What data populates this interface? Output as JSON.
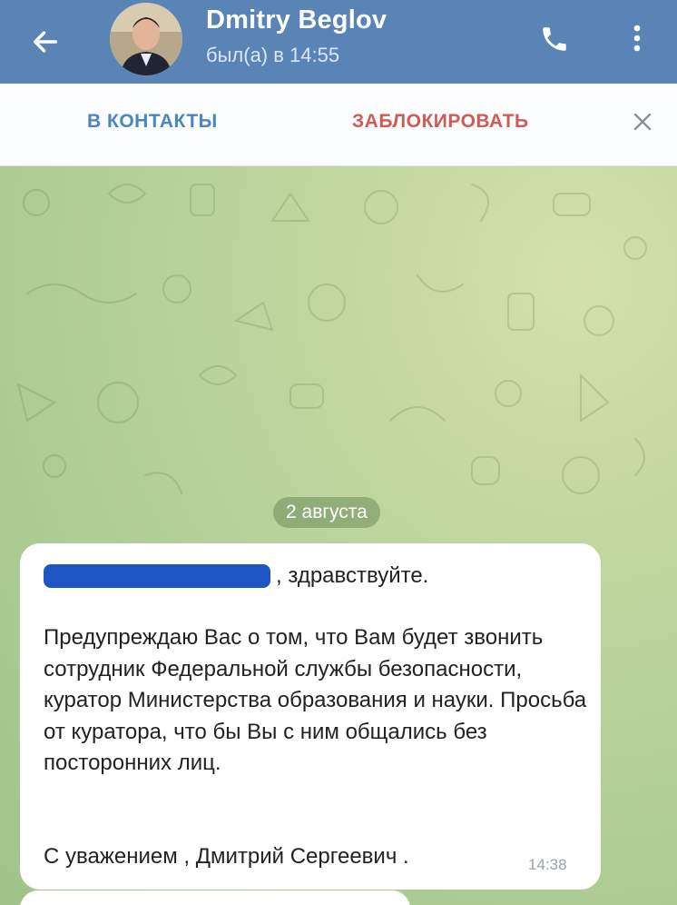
{
  "header": {
    "title": "Dmitry Beglov",
    "status": "был(а) в 14:55",
    "back_icon": "arrow-left-icon",
    "call_icon": "phone-icon",
    "menu_icon": "more-vertical-icon",
    "background": "#5a84b6"
  },
  "actions": {
    "add_contact": "В КОНТАКТЫ",
    "block": "ЗАБЛОКИРОВАТЬ",
    "close_icon": "close-icon"
  },
  "chat": {
    "date": "2 августа",
    "message": {
      "greeting": ", здравствуйте.",
      "body": "Предупреждаю Вас о том, что Вам будет звонить сотрудник Федеральной службы безопасности, куратор Министерства образования и науки. Просьба от куратора, что бы Вы с ним общались без посторонних лиц.",
      "signature": "С уважением , Дмитрий Сергеевич .",
      "time": "14:38"
    }
  },
  "colors": {
    "accent": "#4a86c5",
    "danger": "#d15a55",
    "redaction": "#1e54c4"
  }
}
